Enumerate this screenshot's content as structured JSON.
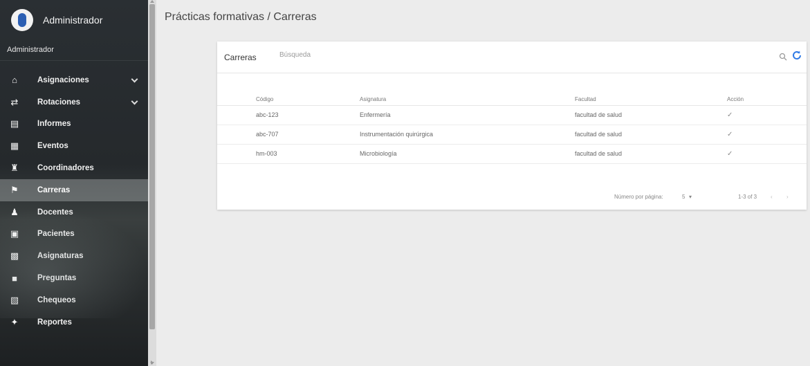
{
  "sidebar": {
    "user_name": "Administrador",
    "role": "Administrador",
    "items": [
      {
        "label": "Asignaciones",
        "icon": "home-icon",
        "glyph": "⌂",
        "chevron": true
      },
      {
        "label": "Rotaciones",
        "icon": "rotations-icon",
        "glyph": "⇄",
        "chevron": true
      },
      {
        "label": "Informes",
        "icon": "report-icon",
        "glyph": "▤",
        "chevron": false
      },
      {
        "label": "Eventos",
        "icon": "calendar-icon",
        "glyph": "▦",
        "chevron": false
      },
      {
        "label": "Coordinadores",
        "icon": "coordinators-icon",
        "glyph": "♜",
        "chevron": false
      },
      {
        "label": "Carreras",
        "icon": "career-icon",
        "glyph": "⚑",
        "chevron": false,
        "active": true
      },
      {
        "label": "Docentes",
        "icon": "teacher-icon",
        "glyph": "♟",
        "chevron": false
      },
      {
        "label": "Pacientes",
        "icon": "patient-icon",
        "glyph": "▣",
        "chevron": false
      },
      {
        "label": "Asignaturas",
        "icon": "subjects-icon",
        "glyph": "▩",
        "chevron": false
      },
      {
        "label": "Preguntas",
        "icon": "question-icon",
        "glyph": "■",
        "chevron": false
      },
      {
        "label": "Chequeos",
        "icon": "checklist-icon",
        "glyph": "▧",
        "chevron": false
      },
      {
        "label": "Reportes",
        "icon": "reports-icon",
        "glyph": "✦",
        "chevron": false
      }
    ]
  },
  "breadcrumb": "Prácticas formativas / Carreras",
  "card": {
    "title": "Carreras",
    "search_placeholder": "Búsqueda",
    "columns": [
      "Código",
      "Asignatura",
      "Facultad",
      "Acción"
    ],
    "rows": [
      {
        "code": "abc-123",
        "subject": "Enfermería",
        "faculty": "facultad de salud",
        "action": "✓"
      },
      {
        "code": "abc-707",
        "subject": "Instrumentación quirúrgica",
        "faculty": "facultad de salud",
        "action": "✓"
      },
      {
        "code": "hm-003",
        "subject": "Microbiología",
        "faculty": "facultad de salud",
        "action": "✓"
      }
    ],
    "pager": {
      "rows_per_page_label": "Número por página:",
      "rows_per_page": "5",
      "range": "1-3 of 3",
      "prev": "‹",
      "next": "›"
    }
  },
  "colors": {
    "accent": "#2f7ae5",
    "active_item_bg": "#8c9090"
  }
}
